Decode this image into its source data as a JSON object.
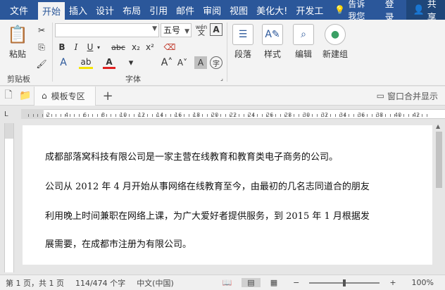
{
  "tabs": [
    {
      "label": "文件"
    },
    {
      "label": "开始"
    },
    {
      "label": "插入"
    },
    {
      "label": "设计"
    },
    {
      "label": "布局"
    },
    {
      "label": "引用"
    },
    {
      "label": "邮件"
    },
    {
      "label": "审阅"
    },
    {
      "label": "视图"
    },
    {
      "label": "美化大!"
    },
    {
      "label": "开发工"
    }
  ],
  "tell_me": "告诉我您",
  "login": "登录",
  "share": "共享",
  "ribbon": {
    "paste_label": "粘贴",
    "clipboard_label": "剪贴板",
    "font_group_label": "字体",
    "font_name_value": "",
    "font_size_value": "五号",
    "wen_glyph": "wén",
    "bold": "B",
    "italic": "I",
    "underline": "U",
    "strike": "abc",
    "subscript": "x₂",
    "superscript": "x²",
    "paragraph": "段落",
    "styles": "样式",
    "editing": "编辑",
    "new_group": "新建组"
  },
  "docbar": {
    "template_tab": "模板专区",
    "merge_label": "窗口合并显示"
  },
  "ruler_numbers": [
    "2",
    "4",
    "6",
    "8",
    "10",
    "12",
    "14",
    "16",
    "18",
    "20",
    "22",
    "24",
    "26",
    "28",
    "30",
    "32",
    "34",
    "36",
    "38",
    "40",
    "42"
  ],
  "document": {
    "paragraphs": [
      "成都部落窝科技有限公司是一家主营在线教育和教育类电子商务的公司。",
      "公司从 2012 年 4 月开始从事网络在线教育至今，由最初的几名志同道合的朋友",
      "利用晚上时间兼职在网络上课，为广大爱好者提供服务，到 2015 年 1 月根据发",
      "展需要，在成都市注册为有限公司。"
    ]
  },
  "status": {
    "page": "第 1 页，共 1 页",
    "words": "114/474 个字",
    "language": "中文(中国)",
    "zoom": "100%",
    "zoom_level": 1.0
  }
}
